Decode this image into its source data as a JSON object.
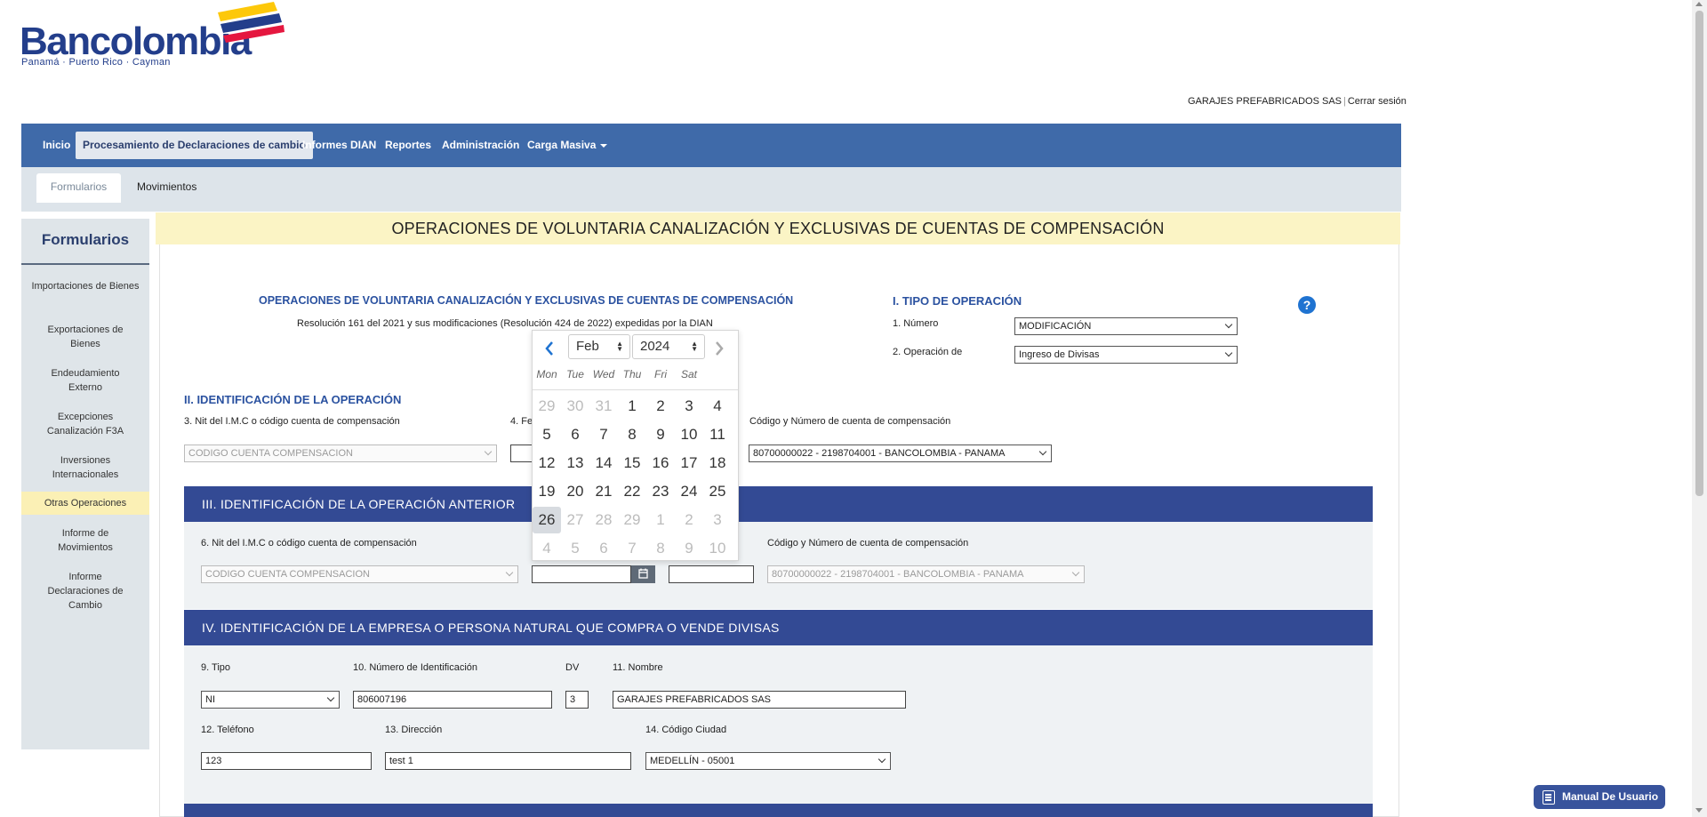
{
  "brand": {
    "name": "Bancolombia",
    "tagline": "Panamá · Puerto Rico · Cayman"
  },
  "user": {
    "company": "GARAJES PREFABRICADOS SAS",
    "logout": "Cerrar sesión"
  },
  "nav": {
    "items": [
      "Inicio",
      "Procesamiento de Declaraciones de cambio",
      "Informes DIAN",
      "Reportes",
      "Administración",
      "Carga Masiva"
    ],
    "active": "Procesamiento de Declaraciones de cambio"
  },
  "subnav": {
    "tabs": [
      "Formularios",
      "Movimientos"
    ],
    "active": "Formularios"
  },
  "sidebar": {
    "title": "Formularios",
    "items": [
      {
        "label": "Importaciones de Bienes"
      },
      {
        "label": "Exportaciones de Bienes"
      },
      {
        "label": "Endeudamiento Externo"
      },
      {
        "label": "Excepciones Canalización F3A"
      },
      {
        "label": "Inversiones Internacionales"
      },
      {
        "label": "Otras Operaciones"
      },
      {
        "label": "Informe de Movimientos"
      },
      {
        "label": "Informe Declaraciones de Cambio"
      }
    ],
    "active": "Otras Operaciones"
  },
  "page": {
    "header": "OPERACIONES DE VOLUNTARIA CANALIZACIÓN Y EXCLUSIVAS DE CUENTAS DE COMPENSACIÓN"
  },
  "form": {
    "title": "OPERACIONES DE VOLUNTARIA CANALIZACIÓN Y EXCLUSIVAS DE CUENTAS DE COMPENSACIÓN",
    "resolution": "Resolución 161 del 2021 y sus modificaciones (Resolución 424 de 2022) expedidas por la DIAN",
    "tipo": {
      "heading": "I. TIPO DE OPERACIÓN",
      "numero_label": "1. Número",
      "numero_value": "MODIFICACIÓN",
      "operacion_label": "2. Operación de",
      "operacion_value": "Ingreso de Divisas"
    },
    "sec2": {
      "heading": "II. IDENTIFICACIÓN DE LA OPERACIÓN",
      "nit_label": "3. Nit del I.M.C o código cuenta de compensación",
      "nit_value": "CODIGO CUENTA COMPENSACION",
      "fecha_label": "4. Fe",
      "cuenta_label": "Código y Número de cuenta de compensación",
      "cuenta_value": "80700000022 - 2198704001 - BANCOLOMBIA - PANAMA"
    },
    "sec3": {
      "heading": "III. IDENTIFICACIÓN DE LA OPERACIÓN ANTERIOR",
      "nit_label": "6. Nit del I.M.C o código cuenta de compensación",
      "nit_value": "CODIGO CUENTA COMPENSACION",
      "fecha_value": "",
      "numero_value": "",
      "cuenta_label": "Código y Número de cuenta de compensación",
      "cuenta_value": "80700000022 - 2198704001 - BANCOLOMBIA - PANAMA"
    },
    "sec4": {
      "heading": "IV. IDENTIFICACIÓN DE LA EMPRESA O PERSONA NATURAL QUE COMPRA O VENDE DIVISAS",
      "tipo_label": "9. Tipo",
      "tipo_value": "NI",
      "id_label": "10. Número de Identificación",
      "id_value": "806007196",
      "dv_label": "DV",
      "dv_value": "3",
      "nombre_label": "11. Nombre",
      "nombre_value": "GARAJES PREFABRICADOS SAS",
      "tel_label": "12. Teléfono",
      "tel_value": "123",
      "dir_label": "13. Dirección",
      "dir_value": "test 1",
      "ciudad_label": "14. Código Ciudad",
      "ciudad_value": "MEDELLÍN - 05001"
    }
  },
  "datepicker": {
    "month": "Feb",
    "year": "2024",
    "weekdays": [
      "Mon",
      "Tue",
      "Wed",
      "Thu",
      "Fri",
      "Sat"
    ],
    "weeks": [
      [
        "29",
        "30",
        "31",
        "1",
        "2",
        "3",
        "4"
      ],
      [
        "5",
        "6",
        "7",
        "8",
        "9",
        "10",
        "11"
      ],
      [
        "12",
        "13",
        "14",
        "15",
        "16",
        "17",
        "18"
      ],
      [
        "19",
        "20",
        "21",
        "22",
        "23",
        "24",
        "25"
      ],
      [
        "26",
        "27",
        "28",
        "29",
        "1",
        "2",
        "3"
      ],
      [
        "4",
        "5",
        "6",
        "7",
        "8",
        "9",
        "10"
      ]
    ],
    "selected": "26"
  },
  "manual": {
    "label": "Manual De Usuario"
  },
  "icons": {
    "help": "help-circle-icon",
    "calendar": "calendar-icon",
    "manual": "document-icon"
  },
  "colors": {
    "nav": "#3f6aa9",
    "section": "#334a94",
    "header_bg": "#fbf4c5",
    "accent_blue": "#2b52a0"
  }
}
